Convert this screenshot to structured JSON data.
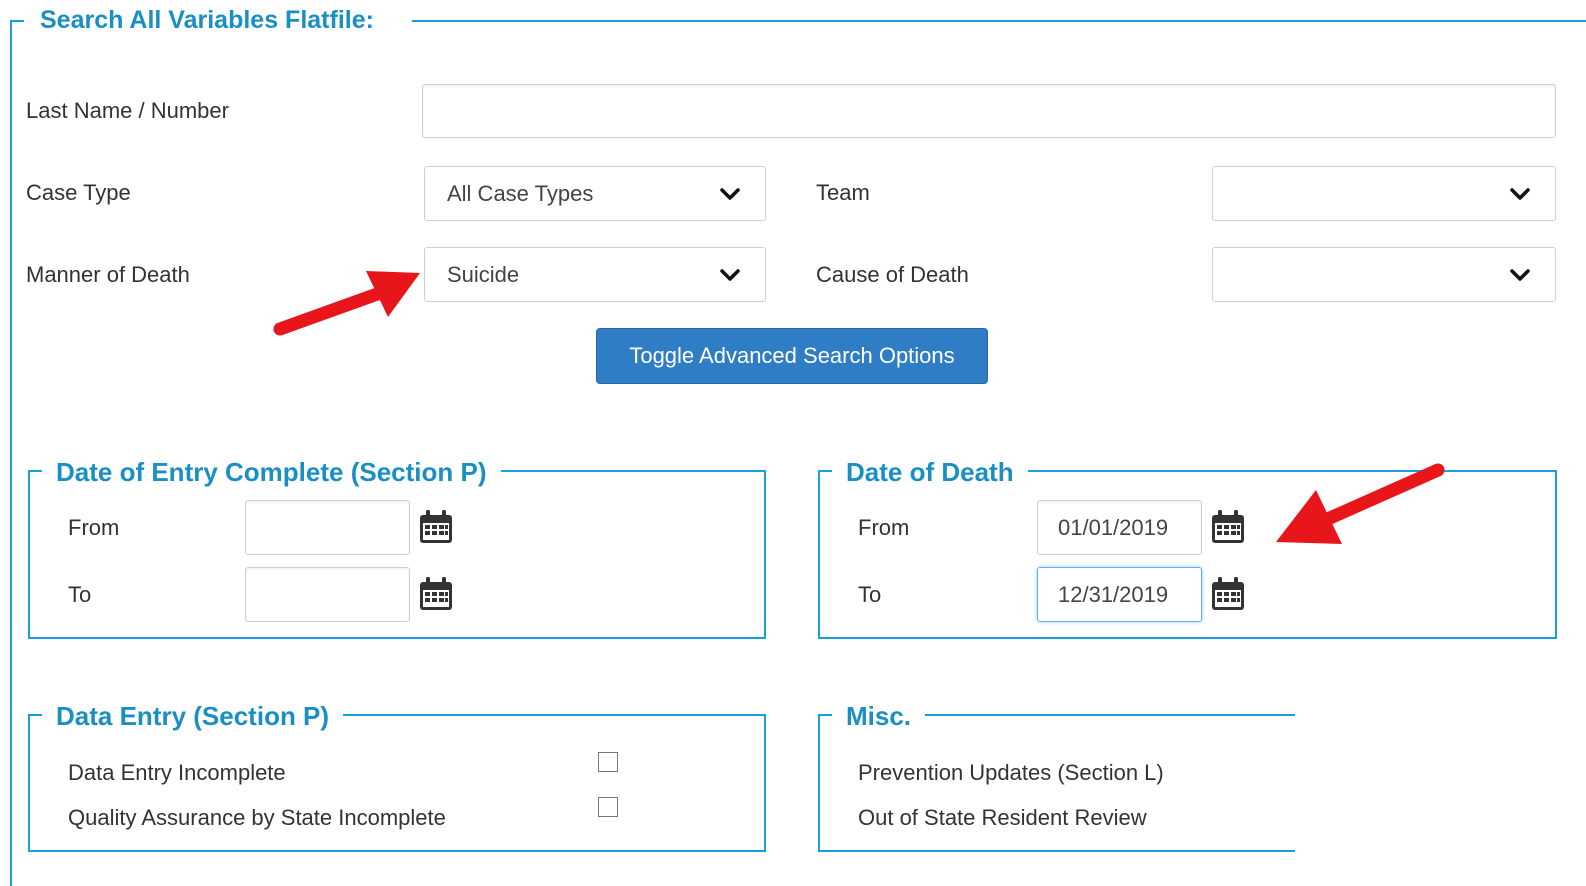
{
  "form": {
    "title": "Search All Variables Flatfile:",
    "last_name_label": "Last Name / Number",
    "last_name_value": "",
    "case_type_label": "Case Type",
    "case_type_value": "All Case Types",
    "team_label": "Team",
    "team_value": "",
    "manner_label": "Manner of Death",
    "manner_value": "Suicide",
    "cause_label": "Cause of Death",
    "cause_value": "",
    "toggle_button": "Toggle Advanced Search Options"
  },
  "entry_complete": {
    "title": "Date of Entry Complete (Section P)",
    "from_label": "From",
    "from_value": "",
    "to_label": "To",
    "to_value": ""
  },
  "date_of_death": {
    "title": "Date of Death",
    "from_label": "From",
    "from_value": "01/01/2019",
    "to_label": "To",
    "to_value": "12/31/2019"
  },
  "data_entry": {
    "title": "Data Entry (Section P)",
    "items": [
      {
        "label": "Data Entry Incomplete",
        "checked": false
      },
      {
        "label": "Quality Assurance by State Incomplete",
        "checked": false
      }
    ]
  },
  "misc": {
    "title": "Misc.",
    "items": [
      {
        "label": "Prevention Updates (Section L)"
      },
      {
        "label": "Out of State Resident Review"
      }
    ]
  },
  "icons": {
    "calendar": "calendar-icon",
    "dropdown": "chevron-down-icon",
    "annotation": "red-arrow-annotation"
  },
  "colors": {
    "accent": "#1aa0d8",
    "title": "#1a8fc3",
    "button": "#2f7dc4",
    "arrow": "#e8151b"
  }
}
